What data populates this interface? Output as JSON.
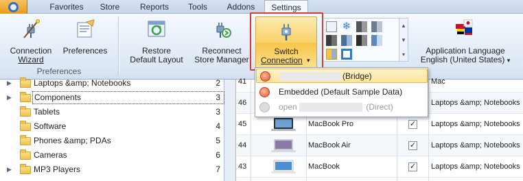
{
  "tabs": [
    {
      "label": "Favorites",
      "active": false
    },
    {
      "label": "Store",
      "active": false
    },
    {
      "label": "Reports",
      "active": false
    },
    {
      "label": "Tools",
      "active": false
    },
    {
      "label": "Addons",
      "active": false
    },
    {
      "label": "Settings",
      "active": true
    }
  ],
  "ribbon": {
    "connection_wizard": {
      "line1": "Connection",
      "line2": "Wizard",
      "icon": "connection-wizard-icon"
    },
    "preferences": {
      "label": "Preferences",
      "icon": "preferences-icon"
    },
    "preferences_group": "Preferences",
    "restore_layout": {
      "line1": "Restore",
      "line2": "Default Layout",
      "icon": "restore-layout-icon"
    },
    "reconnect": {
      "line1": "Reconnect",
      "line2": "Store Manager",
      "icon": "reconnect-icon"
    },
    "switch_connection": {
      "line1": "Switch",
      "line2": "Connection",
      "caret": "▾",
      "icon": "plug-icon"
    },
    "app_language": {
      "line1": "Application Language",
      "line2": "English (United States)",
      "caret": "▾",
      "icon": "language-flags-icon"
    },
    "accent_color": "#e0392e"
  },
  "dropdown": {
    "items": [
      {
        "label": "(Bridge)",
        "enabled": true,
        "hovered": true
      },
      {
        "label": "Embedded (Default Sample Data)",
        "enabled": true,
        "hovered": false
      },
      {
        "label_prefix": "open",
        "label_suffix": "(Direct)",
        "enabled": false,
        "hovered": false
      }
    ]
  },
  "tree": {
    "rows": [
      {
        "name": "Laptops &amp; Notebooks",
        "count": "2",
        "expandable": true,
        "selected": false
      },
      {
        "name": "Components",
        "count": "3",
        "expandable": true,
        "selected": true
      },
      {
        "name": "Tablets",
        "count": "3",
        "expandable": false,
        "selected": false
      },
      {
        "name": "Software",
        "count": "4",
        "expandable": false,
        "selected": false
      },
      {
        "name": "Phones &amp; PDAs",
        "count": "5",
        "expandable": false,
        "selected": false
      },
      {
        "name": "Cameras",
        "count": "6",
        "expandable": false,
        "selected": false
      },
      {
        "name": "MP3 Players",
        "count": "7",
        "expandable": true,
        "selected": false
      }
    ]
  },
  "grid": {
    "rows": [
      {
        "id": "41",
        "product": "",
        "checked": false,
        "category": "Mac"
      },
      {
        "id": "46",
        "product": "",
        "checked": true,
        "category": "Laptops &amp; Notebooks"
      },
      {
        "id": "45",
        "product": "MacBook Pro",
        "checked": true,
        "category": "Laptops &amp; Notebooks"
      },
      {
        "id": "44",
        "product": "MacBook Air",
        "checked": true,
        "category": "Laptops &amp; Notebooks"
      },
      {
        "id": "43",
        "product": "MacBook",
        "checked": true,
        "category": "Laptops &amp; Notebooks"
      }
    ]
  }
}
